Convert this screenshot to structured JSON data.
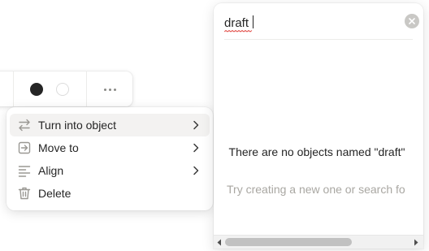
{
  "menu": {
    "items": [
      {
        "label": "Turn into object",
        "icon": "swap-arrows-icon",
        "submenu": true
      },
      {
        "label": "Move to",
        "icon": "move-to-icon",
        "submenu": true
      },
      {
        "label": "Align",
        "icon": "align-left-icon",
        "submenu": true
      },
      {
        "label": "Delete",
        "icon": "trash-icon",
        "submenu": false
      }
    ]
  },
  "toolbar": {
    "colors": [
      "#252525",
      "#ffffff"
    ],
    "more_icon": "more-horizontal-icon"
  },
  "search": {
    "value": "draft",
    "clear_icon": "clear-circle-icon",
    "empty_title": "There are no objects named \"draft\"",
    "empty_hint": "Try creating a new one or search fo"
  },
  "colors": {
    "text": "#252525",
    "muted": "#a9a7a2",
    "highlight": "#f3f2f1",
    "icon": "#9a9893"
  }
}
